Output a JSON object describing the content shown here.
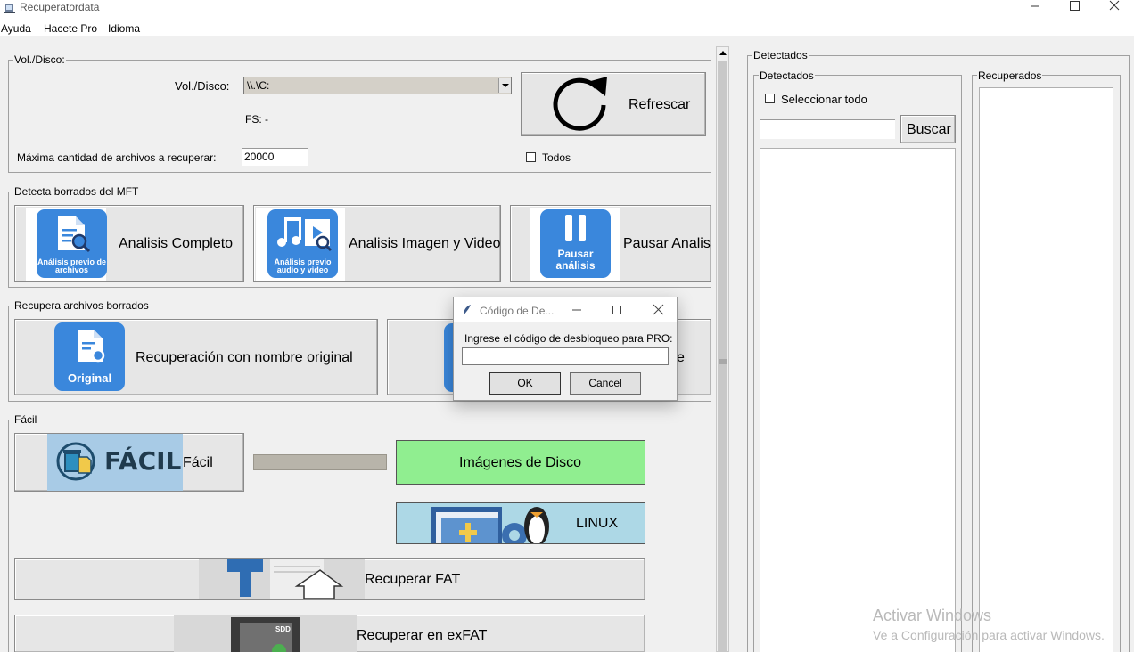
{
  "window": {
    "title": "Recuperatordata"
  },
  "menu": [
    "Ayuda",
    "Hacete Pro",
    "Idioma"
  ],
  "vol_group": {
    "title": "Vol./Disco:",
    "vol_label": "Vol./Disco:",
    "vol_value": "\\\\.\\C:",
    "fs_label": "FS: -",
    "max_label": "Máxima cantidad de archivos a recuperar:",
    "max_value": "20000",
    "refresh_label": "Refrescar",
    "todos_label": "Todos"
  },
  "mft_group": {
    "title": "Detecta borrados del MFT",
    "full_label": "Analisis Completo",
    "full_tile": "Análisis previo de archivos",
    "media_label": "Analisis Imagen y Video",
    "media_tile": "Análisis previo audio y video",
    "pause_label": "Pausar Analisi",
    "pause_tile": "Pausar análisis"
  },
  "recover_group": {
    "title": "Recupera archivos borrados",
    "original_label": "Recuperación con nombre original",
    "original_tile": "Original",
    "second_label": "e"
  },
  "easy_group": {
    "title": "Fácil",
    "easy_label": "Fácil",
    "easy_tile": "FÁCIL",
    "images_label": "Imágenes de Disco",
    "linux_label": "LINUX",
    "fat_label": "Recuperar FAT",
    "exfat_label": "Recuperar en exFAT",
    "sdd_text": "SDD"
  },
  "right_panel": {
    "title": "Detectados",
    "detected_title": "Detectados",
    "select_all": "Seleccionar todo",
    "search_label": "Buscar",
    "recovered_title": "Recuperados"
  },
  "dialog": {
    "title": "Código de De...",
    "prompt": "Ingrese el código de desbloqueo para PRO:",
    "ok": "OK",
    "cancel": "Cancel"
  },
  "watermark": {
    "line1": "Activar Windows",
    "line2": "Ve a Configuración para activar Windows."
  },
  "colors": {
    "tile_blue": "#3a87dc",
    "images_green": "#90ee90",
    "linux_blue": "#add8e6",
    "easy_bg": "#a8cbe6"
  }
}
